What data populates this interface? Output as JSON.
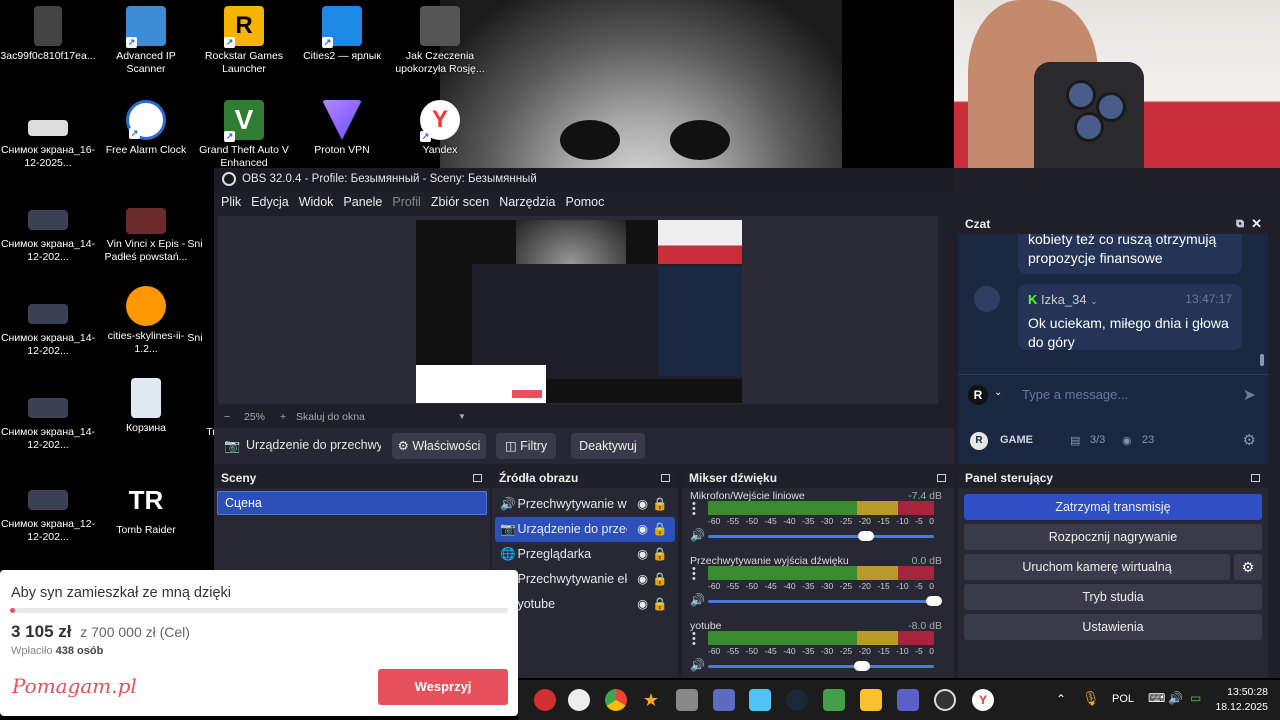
{
  "desktop": {
    "icons": [
      {
        "label": "3ac99f0c810f17ea..."
      },
      {
        "label": "Advanced IP Scanner"
      },
      {
        "label": "Rockstar Games Launcher"
      },
      {
        "label": "Cities2 — ярлык"
      },
      {
        "label": "Jak Czeczenia upokorzyła Rosję..."
      },
      {
        "label": "Снимок экрана_16-12-2025..."
      },
      {
        "label": "Free Alarm Clock"
      },
      {
        "label": "Grand Theft Auto V Enhanced"
      },
      {
        "label": "Proton VPN"
      },
      {
        "label": "Yandex"
      },
      {
        "label": "Снимок экрана_14-12-202..."
      },
      {
        "label": "Vin Vinci x Epis - Padłeś powstań..."
      },
      {
        "label": "Sni"
      },
      {
        "label": "Снимок экрана_14-12-202..."
      },
      {
        "label": "cities-skylines-ii-1.2..."
      },
      {
        "label": "Sni"
      },
      {
        "label": "Снимок экрана_14-12-202..."
      },
      {
        "label": "Корзина"
      },
      {
        "label": "Tr"
      },
      {
        "label": "Снимок экрана_12-12-202..."
      },
      {
        "label": "Tomb Raider"
      }
    ]
  },
  "obs": {
    "title": "OBS 32.0.4 - Profile: Безымянный - Sceny: Безымянный",
    "menu": [
      "Plik",
      "Edycja",
      "Widok",
      "Panele",
      "Profil",
      "Zbiór scen",
      "Narzędzia",
      "Pomoc"
    ],
    "zoom": "25%",
    "zoom_minus": "−",
    "zoom_plus": "+",
    "scale_label": "Skaluj do okna",
    "source_toolbar": {
      "source_name": "Urządzenie do przechwyty",
      "properties": "Właściwości",
      "filters": "Filtry",
      "deactivate": "Deaktywuj"
    },
    "scenes": {
      "title": "Sceny",
      "items": [
        "Сцена"
      ]
    },
    "sources": {
      "title": "Źródła obrazu",
      "items": [
        {
          "icon": "🔊",
          "name": "Przechwytywanie wyjś"
        },
        {
          "icon": "📷",
          "name": "Urządzenie do przech"
        },
        {
          "icon": "🌐",
          "name": "Przeglądarka"
        },
        {
          "icon": "▭",
          "name": "Przechwytywanie ekra"
        },
        {
          "icon": "",
          "name": "yotube"
        }
      ]
    },
    "mixer": {
      "title": "Mikser dźwięku",
      "scale": [
        "-60",
        "-55",
        "-50",
        "-45",
        "-40",
        "-35",
        "-30",
        "-25",
        "-20",
        "-15",
        "-10",
        "-5",
        "0"
      ],
      "channels": [
        {
          "name": "Mikrofon/Wejście liniowe",
          "db": "-7.4 dB",
          "volume": 0.7
        },
        {
          "name": "Przechwytywanie wyjścia dźwięku",
          "db": "0.0 dB",
          "volume": 1.0
        },
        {
          "name": "yotube",
          "db": "-8.0 dB",
          "volume": 0.68
        }
      ]
    },
    "controls": {
      "title": "Panel sterujący",
      "stop_stream": "Zatrzymaj transmisję",
      "start_recording": "Rozpocznij nagrywanie",
      "virtual_camera": "Uruchom kamerę wirtualną",
      "studio_mode": "Tryb studia",
      "settings": "Ustawienia"
    },
    "chat": {
      "title": "Czat",
      "partial_message": "kobiety też co ruszą otrzymują propozycje finansowe",
      "message_user": "Izka_34",
      "message_time": "13:47:17",
      "message_text": "Ok uciekam, miłego dnia i głowa do góry",
      "input_badge": "R",
      "input_placeholder": "Type a message...",
      "footer_badge": "R",
      "footer_label": "GAME",
      "footer_users": "3/3",
      "footer_viewers": "23"
    }
  },
  "donation": {
    "title": "Aby syn zamieszkał ze mną dzięki",
    "amount": "3 105 zł",
    "goal": "z 700 000 zł (Cel)",
    "payers_prefix": "Wpłaciło",
    "payers": "438 osób",
    "progress": 0.0044,
    "logo": "Pomagam.pl",
    "button": "Wesprzyj"
  },
  "taskbar": {
    "language": "POL",
    "time": "13:50:28",
    "date": "18.12.2025"
  },
  "colors": {
    "accent": "#2f4fc6",
    "donate_button": "#e8505b",
    "chat_bg": "#1a2740"
  }
}
